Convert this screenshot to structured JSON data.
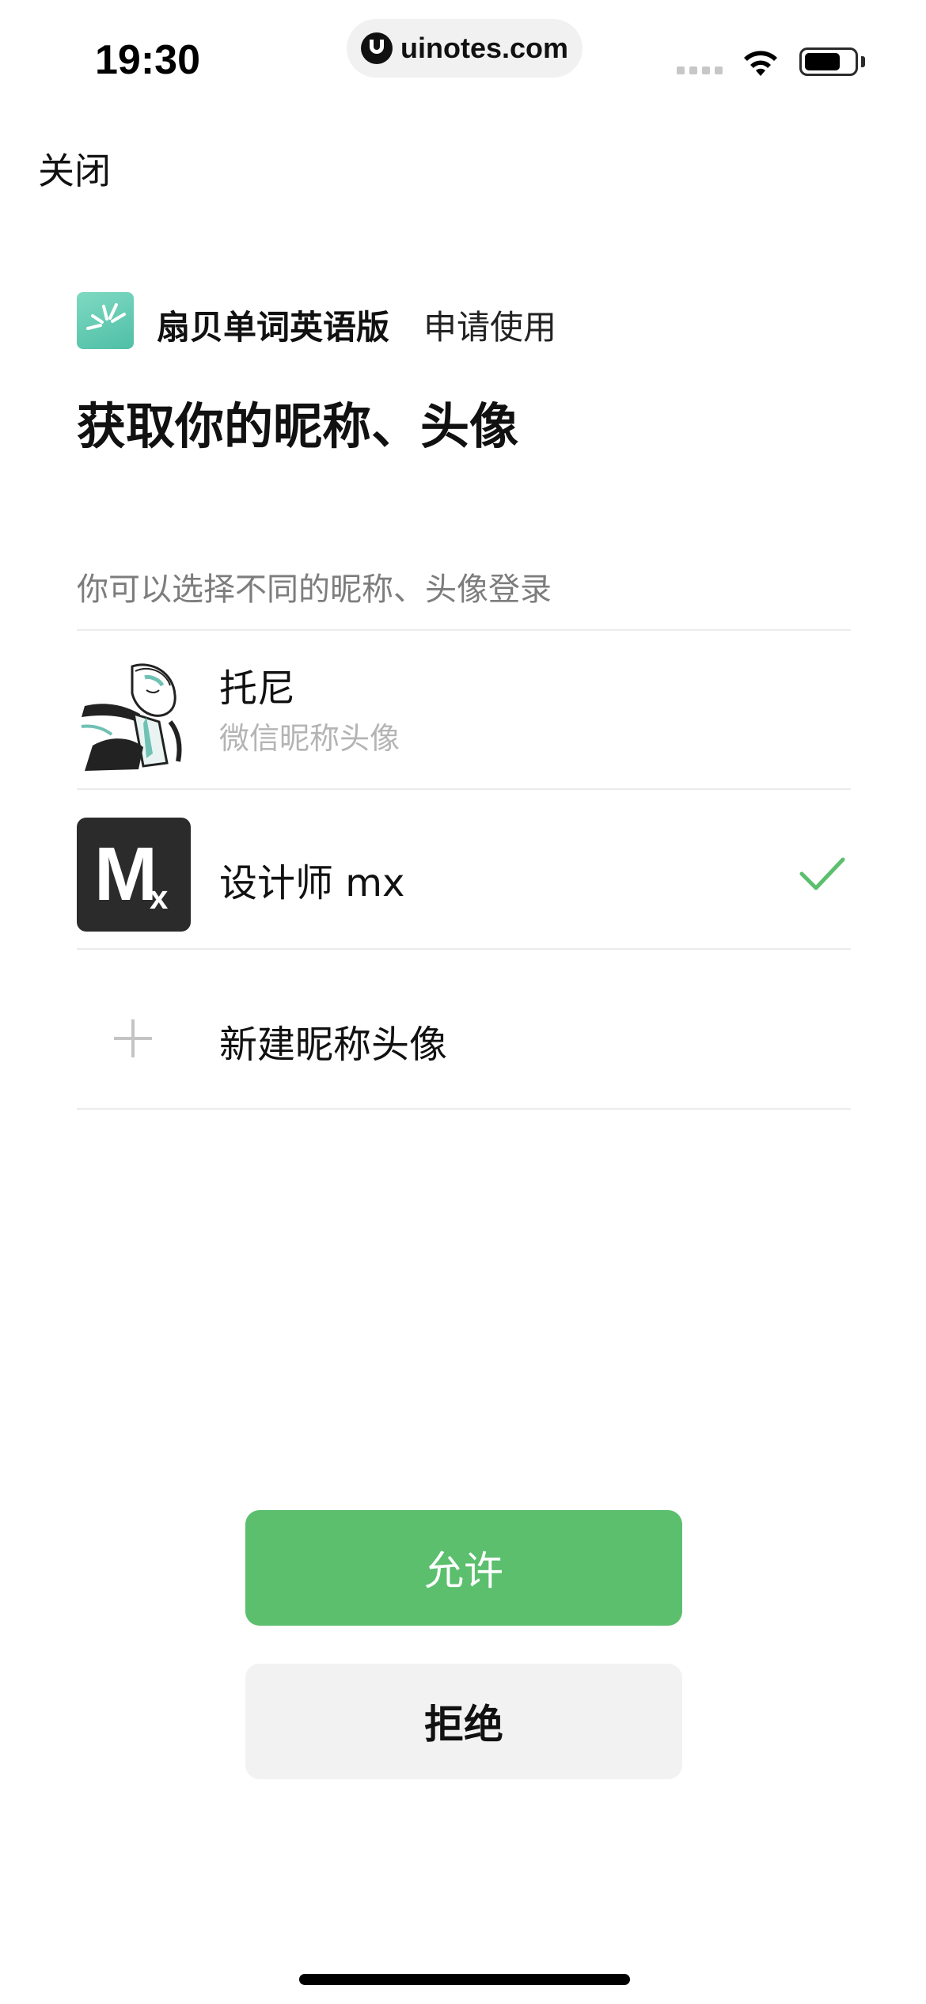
{
  "status_bar": {
    "time": "19:30",
    "url": "uinotes.com",
    "icons": [
      "signal-icon",
      "wifi-icon",
      "battery-icon"
    ]
  },
  "header": {
    "close_label": "关闭"
  },
  "app": {
    "name": "扇贝单词英语版",
    "request_text": "申请使用",
    "icon": "app-logo-icon"
  },
  "title": "获取你的昵称、头像",
  "hint": "你可以选择不同的昵称、头像登录",
  "options": [
    {
      "name": "托尼",
      "subtitle": "微信昵称头像",
      "selected": false
    },
    {
      "name": "设计师 mx",
      "avatar_text": "M",
      "avatar_sub": "x",
      "selected": true
    },
    {
      "name": "新建昵称头像",
      "icon": "plus-icon"
    }
  ],
  "buttons": {
    "allow": "允许",
    "deny": "拒绝"
  },
  "colors": {
    "accent": "#5bbf6d",
    "check": "#5bbf6d",
    "deny_bg": "#f2f2f2"
  }
}
